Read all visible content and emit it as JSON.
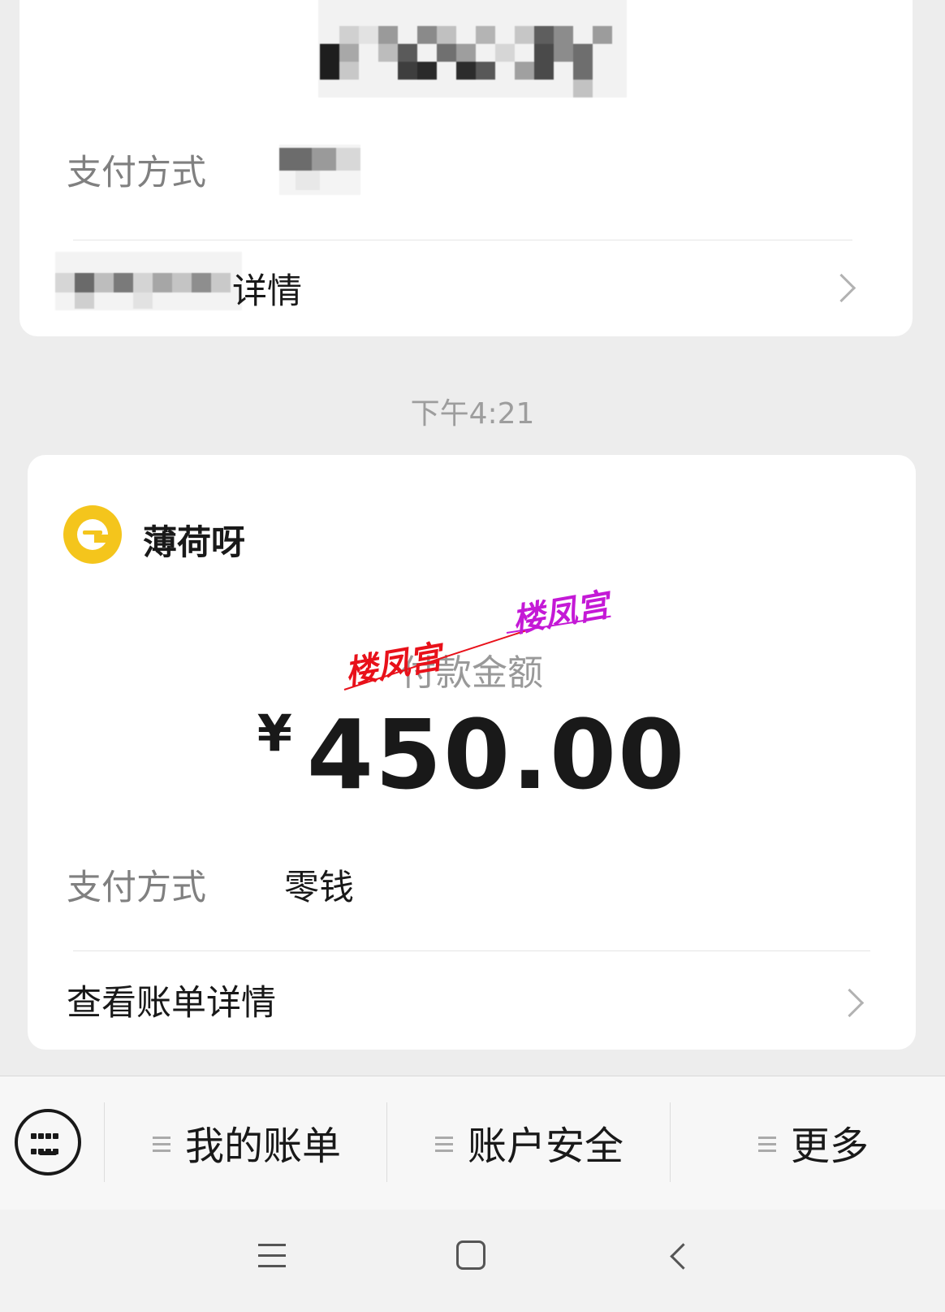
{
  "previous_card": {
    "payment_method_label": "支付方式",
    "view_details_suffix": "详情"
  },
  "timestamp": "下午4:21",
  "current_card": {
    "merchant_name": "薄荷呀",
    "amount_label": "付款金额",
    "currency_symbol": "¥",
    "amount": "450.00",
    "payment_method_label": "支付方式",
    "payment_method_value": "零钱",
    "view_details_label": "查看账单详情",
    "watermarks": [
      "楼凤宫",
      "楼凤宫"
    ]
  },
  "menu": {
    "items": [
      "我的账单",
      "账户安全",
      "更多"
    ]
  },
  "colors": {
    "background": "#ededed",
    "card": "#ffffff",
    "merchant_logo": "#f4c51c",
    "watermark_red": "#e8111a",
    "watermark_purple": "#c419d6"
  },
  "icons": {
    "keyboard": "keyboard-icon",
    "chevron": "chevron-right-icon",
    "menu_item": "hamburger-icon",
    "nav_menu": "nav-menu-icon",
    "nav_home": "nav-home-icon",
    "nav_back": "nav-back-icon"
  }
}
